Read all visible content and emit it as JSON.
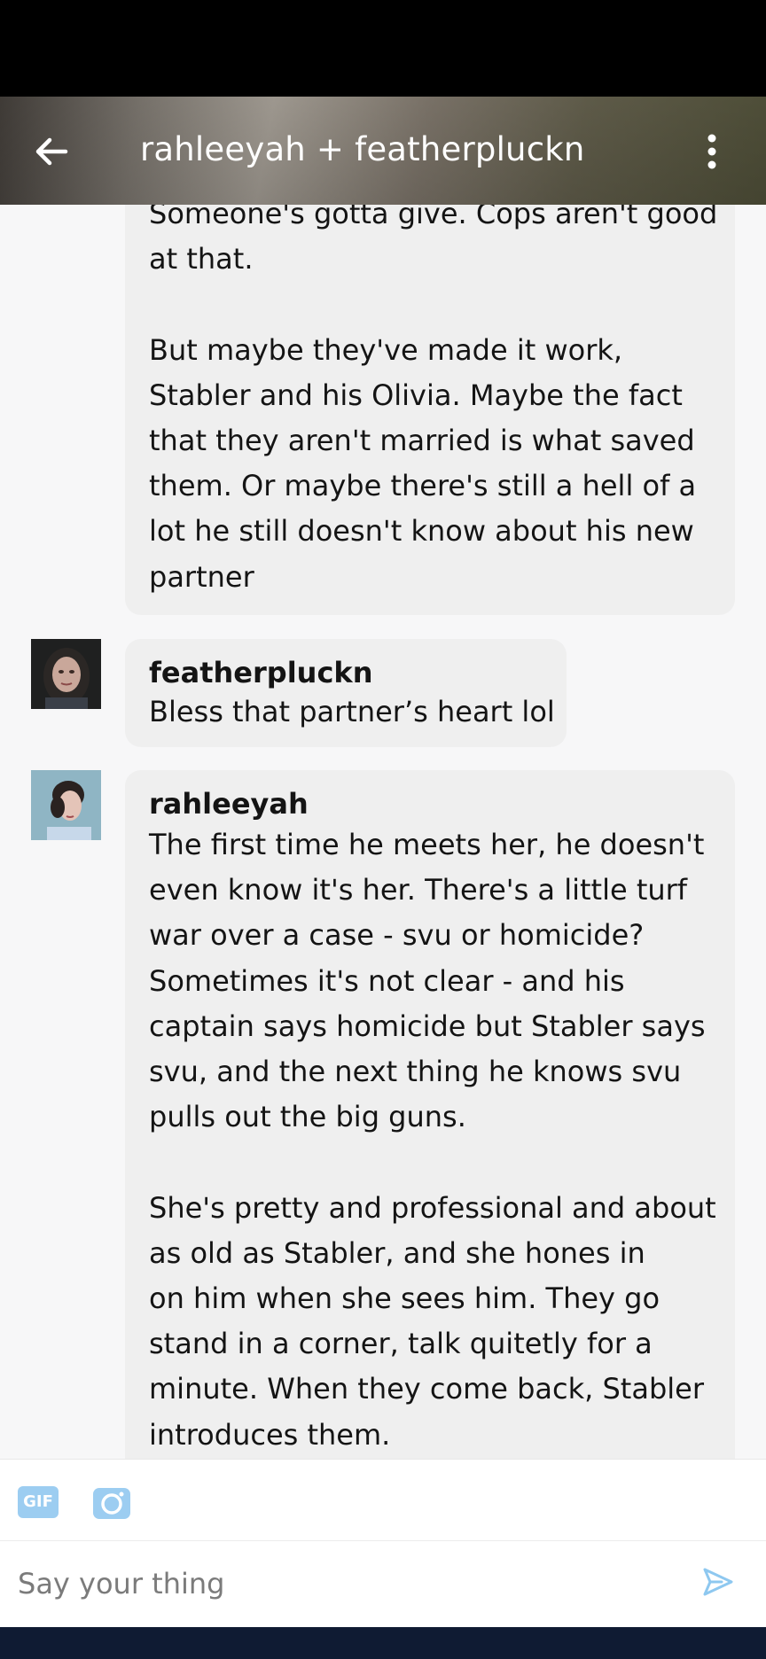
{
  "header": {
    "title": "rahleeyah + featherpluckn",
    "back_icon": "arrow-left-icon",
    "menu_icon": "more-vertical-icon"
  },
  "messages": [
    {
      "author": "",
      "text": "Someone's gotta give. Cops aren't good\nat that.\n\nBut maybe they've made it work,\nStabler and his Olivia. Maybe the fact\nthat they aren't married is what saved\nthem. Or maybe there's still a hell of a\nlot he still doesn't know about his new\npartner"
    },
    {
      "author": "featherpluckn",
      "text": "Bless that partner’s heart lol"
    },
    {
      "author": "rahleeyah",
      "text": "The first time he meets her, he doesn't\neven know it's her. There's a little turf\nwar over a case - svu or homicide?\nSometimes it's not clear - and his\ncaptain says homicide but Stabler says\nsvu, and the next thing he knows svu\npulls out the big guns.\n\nShe's pretty and professional and about\nas old as Stabler, and she hones in\non him when she sees him. They go\nstand in a corner, talk quitetly for a\nminute. When they come back, Stabler\nintroduces them."
    }
  ],
  "composer": {
    "gif_label": "GIF",
    "camera_icon": "camera-icon",
    "placeholder": "Say your thing",
    "send_icon": "send-icon"
  },
  "colors": {
    "accent": "#8ec8f0",
    "bubble": "#efefef",
    "background": "#f7f7f8",
    "nav_bar": "#0f1b33"
  }
}
